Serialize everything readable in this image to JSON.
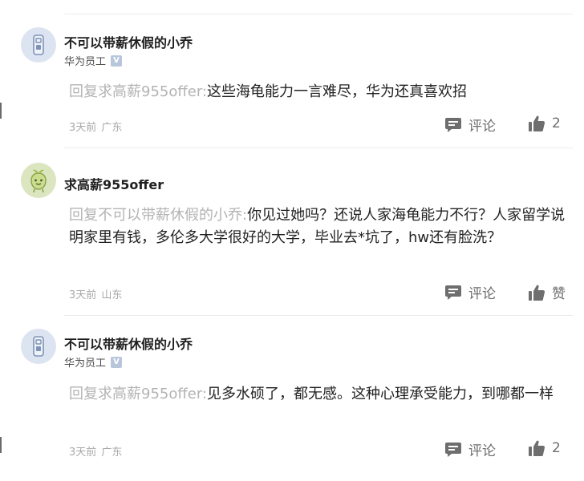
{
  "comments": [
    {
      "author": "不可以带薪休假的小乔",
      "role": "华为员工",
      "badge": "V",
      "reply_prefix": "回复求高薪955offer:",
      "text": "这些海龟能力一言难尽，华为还真喜欢招",
      "time": "3天前",
      "location": "广东",
      "comment_label": "评论",
      "like_label": "2"
    },
    {
      "author": "求高薪955offer",
      "reply_prefix": "回复不可以带薪休假的小乔:",
      "text": "你见过她吗？还说人家海龟能力不行？人家留学说明家里有钱，多伦多大学很好的大学，毕业去*坑了，hw还有脸洗？",
      "time": "3天前",
      "location": "山东",
      "comment_label": "评论",
      "like_label": "赞"
    },
    {
      "author": "不可以带薪休假的小乔",
      "role": "华为员工",
      "badge": "V",
      "reply_prefix": "回复求高薪955offer:",
      "text": "见多水硕了，都无感。这种心理承受能力，到哪都一样",
      "time": "3天前",
      "location": "广东",
      "comment_label": "评论",
      "like_label": "2"
    }
  ],
  "icons": {
    "avatar_blue": "usb-drive-icon",
    "avatar_green": "cartoon-sprout-icon",
    "comment": "comment-bubble-icon",
    "like": "thumbs-up-icon"
  },
  "colors": {
    "name": "#1f1f1f",
    "reply_prefix": "#b3b3b3",
    "meta": "#a8a8a8",
    "action": "#6e6e6e",
    "badge": "#b8c6dc"
  }
}
